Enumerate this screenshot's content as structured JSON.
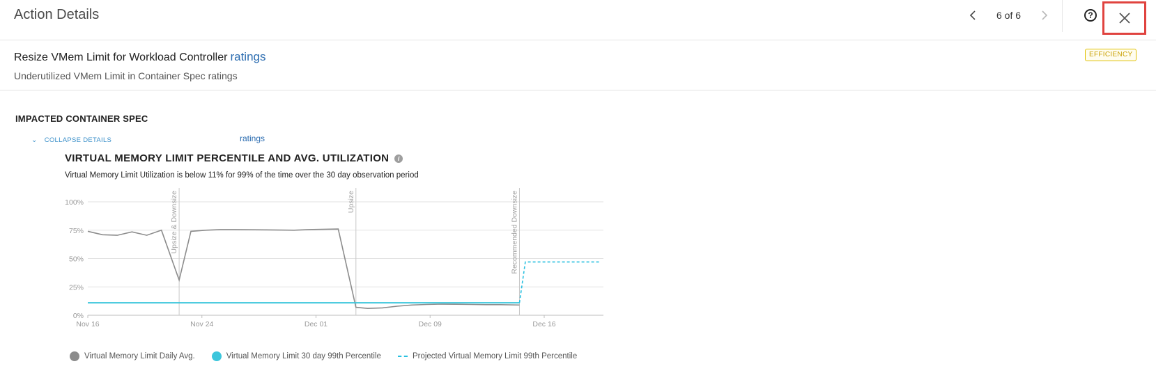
{
  "header": {
    "title": "Action Details",
    "pager": {
      "prev_icon": "chevron-left-icon",
      "count": "6 of 6",
      "next_icon": "chevron-right-icon"
    },
    "help_icon": "help-circle-icon",
    "close_icon": "close-icon"
  },
  "summary": {
    "title": "Resize VMem Limit for Workload Controller",
    "title_link": "ratings",
    "subtitle": "Underutilized VMem Limit in Container Spec ratings",
    "badge": "EFFICIENCY"
  },
  "section": {
    "title": "IMPACTED CONTAINER SPEC",
    "collapse_label": "COLLAPSE DETAILS",
    "entity_link": "ratings"
  },
  "chart_header": {
    "title": "VIRTUAL MEMORY LIMIT PERCENTILE AND AVG. UTILIZATION",
    "subtitle": "Virtual Memory Limit Utilization is below 11% for 99% of the time over the 30 day observation period"
  },
  "colors": {
    "daily_avg": "#8c8c8c",
    "percentile": "#3cc6dc",
    "projected": "#29c0e0",
    "close_highlight": "#e0433f",
    "badge": "#c9a000"
  },
  "chart_data": {
    "type": "line",
    "title": "VIRTUAL MEMORY LIMIT PERCENTILE AND AVG. UTILIZATION",
    "x_ticks": [
      "Nov 16",
      "Nov 24",
      "Dec 01",
      "Dec 09",
      "Dec 16"
    ],
    "x_range_days": [
      0,
      35
    ],
    "y_ticks": [
      "100%",
      "75%",
      "50%",
      "25%",
      "0%"
    ],
    "ylim": [
      0,
      100
    ],
    "grid": true,
    "legend_position": "bottom",
    "markers": [
      {
        "day": 6.2,
        "label": "Upsize & Downsize"
      },
      {
        "day": 18.2,
        "label": "Upsize"
      },
      {
        "day": 29.3,
        "label": "Recommended Downsize"
      }
    ],
    "series": [
      {
        "name": "Virtual Memory Limit Daily Avg.",
        "style": "solid",
        "x": [
          0,
          1,
          2,
          3,
          4,
          5,
          6.2,
          7,
          8,
          9,
          10,
          12,
          14,
          15,
          17,
          18.2,
          19,
          20,
          21,
          22,
          23,
          24,
          25,
          26,
          27,
          28,
          29.3
        ],
        "y": [
          74,
          71,
          70.5,
          73.5,
          70.5,
          75,
          31,
          74,
          75,
          75.5,
          75.5,
          75.3,
          75,
          75.5,
          76,
          7,
          6,
          6.5,
          8,
          9,
          9.5,
          9.8,
          9.7,
          9.5,
          9.3,
          9.3,
          9
        ]
      },
      {
        "name": "Virtual Memory Limit 30 day 99th Percentile",
        "style": "solid",
        "x": [
          0,
          5,
          6.2,
          10,
          18.2,
          25,
          29.3
        ],
        "y": [
          11,
          11,
          11,
          11,
          11,
          11,
          11
        ]
      },
      {
        "name": "Projected Virtual Memory Limit 99th Percentile",
        "style": "dashed",
        "x": [
          29.3,
          29.7,
          32,
          34.7
        ],
        "y": [
          11,
          47,
          47,
          47
        ]
      }
    ]
  },
  "legend": [
    {
      "label": "Virtual Memory Limit Daily Avg."
    },
    {
      "label": "Virtual Memory Limit 30 day 99th Percentile"
    },
    {
      "label": "Projected Virtual Memory Limit 99th Percentile"
    }
  ]
}
